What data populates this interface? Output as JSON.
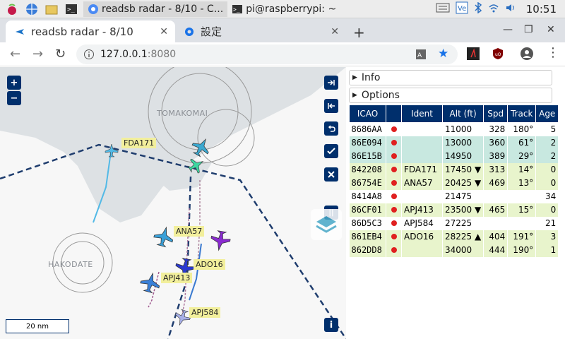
{
  "taskbar": {
    "tasks": [
      {
        "label": "readsb radar - 8/10 - C...",
        "icon": "chromium-icon"
      },
      {
        "label": "pi@raspberrypi: ~",
        "icon": "terminal-icon"
      }
    ],
    "clock": "10:51"
  },
  "browser": {
    "tabs": [
      {
        "label": "readsb radar - 8/10",
        "icon": "plane-icon"
      },
      {
        "label": "設定",
        "icon": "gear-icon"
      }
    ],
    "url_host": "127.0.0.1",
    "url_port": ":8080"
  },
  "map": {
    "places": [
      "TOMAKOMAI",
      "HAKODATE"
    ],
    "flight_labels": [
      "FDA171",
      "ANA57",
      "ADO16",
      "APJ413",
      "APJ584"
    ],
    "scale": "20 nm",
    "zoom_in": "+",
    "zoom_out": "−",
    "info": "i",
    "pause": "||"
  },
  "panel": {
    "info_label": "Info",
    "options_label": "Options",
    "columns": [
      "ICAO",
      "",
      "Ident",
      "Alt (ft)",
      "Spd",
      "Track",
      "Age"
    ],
    "rows": [
      {
        "icao": "8686AA",
        "ident": "",
        "alt": "11000",
        "spd": "328",
        "track": "180°",
        "age": "5",
        "bg": "#ffffff"
      },
      {
        "icao": "86E094",
        "ident": "",
        "alt": "13000",
        "spd": "360",
        "track": "61°",
        "age": "2",
        "bg": "#c8e8e0"
      },
      {
        "icao": "86E15B",
        "ident": "",
        "alt": "14950",
        "spd": "389",
        "track": "29°",
        "age": "2",
        "bg": "#c8e8e0"
      },
      {
        "icao": "842208",
        "ident": "FDA171",
        "alt": "17450 ▼",
        "spd": "313",
        "track": "14°",
        "age": "0",
        "bg": "#e8f4cc"
      },
      {
        "icao": "86754E",
        "ident": "ANA57",
        "alt": "20425 ▼",
        "spd": "469",
        "track": "13°",
        "age": "0",
        "bg": "#e8f4cc"
      },
      {
        "icao": "8414A8",
        "ident": "",
        "alt": "21475",
        "spd": "",
        "track": "",
        "age": "34",
        "bg": "#ffffff"
      },
      {
        "icao": "86CF01",
        "ident": "APJ413",
        "alt": "23500 ▼",
        "spd": "465",
        "track": "15°",
        "age": "0",
        "bg": "#e8f4cc"
      },
      {
        "icao": "86D5C3",
        "ident": "APJ584",
        "alt": "27225",
        "spd": "",
        "track": "",
        "age": "21",
        "bg": "#ffffff"
      },
      {
        "icao": "861EB4",
        "ident": "ADO16",
        "alt": "28225 ▲",
        "spd": "404",
        "track": "191°",
        "age": "3",
        "bg": "#e8f4cc"
      },
      {
        "icao": "862DD8",
        "ident": "",
        "alt": "34000",
        "spd": "444",
        "track": "190°",
        "age": "1",
        "bg": "#e8f4cc"
      }
    ]
  }
}
